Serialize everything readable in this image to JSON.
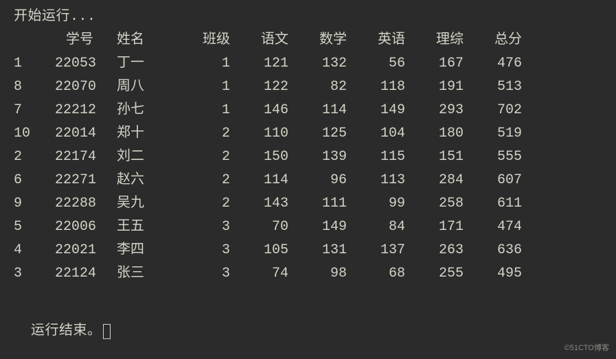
{
  "start_text": "开始运行...",
  "end_text": "运行结束。",
  "watermark": "©51CTO博客",
  "headers": {
    "col0": "",
    "col1": "学号",
    "col2": "姓名",
    "col3": "班级",
    "col4": "语文",
    "col5": "数学",
    "col6": "英语",
    "col7": "理综",
    "col8": "总分"
  },
  "chart_data": {
    "type": "table",
    "columns": [
      "index",
      "学号",
      "姓名",
      "班级",
      "语文",
      "数学",
      "英语",
      "理综",
      "总分"
    ],
    "rows": [
      {
        "idx": "1",
        "id": "22053",
        "name": "丁一",
        "class": "1",
        "chinese": "121",
        "math": "132",
        "english": "56",
        "sci": "167",
        "total": "476"
      },
      {
        "idx": "8",
        "id": "22070",
        "name": "周八",
        "class": "1",
        "chinese": "122",
        "math": "82",
        "english": "118",
        "sci": "191",
        "total": "513"
      },
      {
        "idx": "7",
        "id": "22212",
        "name": "孙七",
        "class": "1",
        "chinese": "146",
        "math": "114",
        "english": "149",
        "sci": "293",
        "total": "702"
      },
      {
        "idx": "10",
        "id": "22014",
        "name": "郑十",
        "class": "2",
        "chinese": "110",
        "math": "125",
        "english": "104",
        "sci": "180",
        "total": "519"
      },
      {
        "idx": "2",
        "id": "22174",
        "name": "刘二",
        "class": "2",
        "chinese": "150",
        "math": "139",
        "english": "115",
        "sci": "151",
        "total": "555"
      },
      {
        "idx": "6",
        "id": "22271",
        "name": "赵六",
        "class": "2",
        "chinese": "114",
        "math": "96",
        "english": "113",
        "sci": "284",
        "total": "607"
      },
      {
        "idx": "9",
        "id": "22288",
        "name": "吴九",
        "class": "2",
        "chinese": "143",
        "math": "111",
        "english": "99",
        "sci": "258",
        "total": "611"
      },
      {
        "idx": "5",
        "id": "22006",
        "name": "王五",
        "class": "3",
        "chinese": "70",
        "math": "149",
        "english": "84",
        "sci": "171",
        "total": "474"
      },
      {
        "idx": "4",
        "id": "22021",
        "name": "李四",
        "class": "3",
        "chinese": "105",
        "math": "131",
        "english": "137",
        "sci": "263",
        "total": "636"
      },
      {
        "idx": "3",
        "id": "22124",
        "name": "张三",
        "class": "3",
        "chinese": "74",
        "math": "98",
        "english": "68",
        "sci": "255",
        "total": "495"
      }
    ]
  }
}
